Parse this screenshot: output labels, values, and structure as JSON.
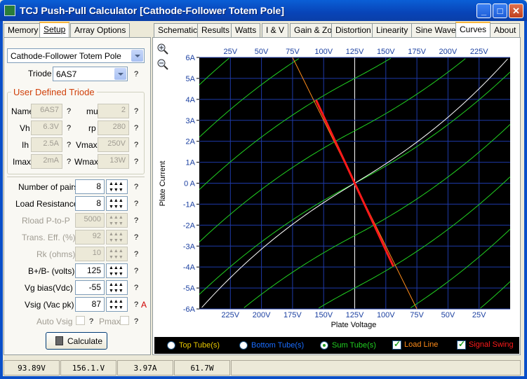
{
  "window": {
    "title": "TCJ Push-Pull Calculator [Cathode-Follower Totem Pole]",
    "minimize": "_",
    "maximize": "□",
    "close": "✕"
  },
  "left_tabs": [
    {
      "label": "Memory"
    },
    {
      "label": "Setup"
    },
    {
      "label": "Array Options"
    }
  ],
  "right_tabs": [
    {
      "label": "Schematic"
    },
    {
      "label": "Results"
    },
    {
      "label": "Watts"
    },
    {
      "label": "I & V"
    },
    {
      "label": "Gain & Zo"
    },
    {
      "label": "Distortion"
    },
    {
      "label": "Linearity"
    },
    {
      "label": "Sine Wave"
    },
    {
      "label": "Curves"
    },
    {
      "label": "About"
    }
  ],
  "setup": {
    "topology": "Cathode-Follower Totem Pole",
    "triode_label": "Triode",
    "triode_value": "6AS7",
    "group_title": "User Defined Triode",
    "user_triode": {
      "name_label": "Name",
      "name_value": "6AS7",
      "mu_label": "mu",
      "mu_value": "2",
      "vh_label": "Vh",
      "vh_value": "6.3V",
      "rp_label": "rp",
      "rp_value": "280",
      "ih_label": "Ih",
      "ih_value": "2.5A",
      "vmax_label": "Vmax",
      "vmax_value": "250V",
      "imax_label": "Imax",
      "imax_value": "2mA",
      "wmax_label": "Wmax",
      "wmax_value": "13W"
    },
    "fields": [
      {
        "label": "Number of pairs",
        "value": "8"
      },
      {
        "label": "Load Resistance",
        "value": "8"
      },
      {
        "label": "Rload P-to-P",
        "value": "5000"
      },
      {
        "label": "Trans. Eff. (%)",
        "value": "92"
      },
      {
        "label": "Rk (ohms)",
        "value": "10"
      },
      {
        "label": "B+/B- (volts)",
        "value": "125"
      },
      {
        "label": "Vg bias(Vdc)",
        "value": "-55"
      },
      {
        "label": "Vsig (Vac pk)",
        "value": "87"
      }
    ],
    "help": "?",
    "vsig_flag": "A",
    "auto_vsig": "Auto Vsig",
    "pmax": "Pmax",
    "calculate": "Calculate"
  },
  "status": [
    "93.89V",
    "156.1.V",
    "3.97A",
    "61.7W"
  ],
  "legend": [
    {
      "label": "Top Tube(s)",
      "color": "#e8c800",
      "selected": false,
      "type": "radio"
    },
    {
      "label": "Bottom Tube(s)",
      "color": "#1a6dff",
      "selected": false,
      "type": "radio"
    },
    {
      "label": "Sum Tube(s)",
      "color": "#21d021",
      "selected": true,
      "type": "radio"
    },
    {
      "label": "Load Line",
      "color": "#ff8c1a",
      "selected": true,
      "type": "check"
    },
    {
      "label": "Signal Swing",
      "color": "#ff1a1a",
      "selected": true,
      "type": "check"
    }
  ],
  "chart_data": {
    "type": "line",
    "xlabel": "Plate Voltage",
    "ylabel": "Plate Current",
    "x_top_ticks": [
      "25V",
      "50V",
      "75V",
      "100V",
      "125V",
      "150V",
      "175V",
      "200V",
      "225V"
    ],
    "x_bottom_ticks": [
      "225V",
      "200V",
      "175V",
      "150V",
      "125V",
      "100V",
      "75V",
      "50V",
      "25V"
    ],
    "y_ticks": [
      "6A",
      "5A",
      "4A",
      "3A",
      "2A",
      "1A",
      "0 A",
      "-1A",
      "-2A",
      "-3A",
      "-4A",
      "-5A",
      "-6A"
    ],
    "xlim": [
      0,
      250
    ],
    "ylim": [
      -6,
      6
    ],
    "grid": true,
    "center_x": 125,
    "family_offsets": [
      -10,
      -7.5,
      -5,
      -2.5,
      0,
      2.5,
      5,
      7.5,
      10
    ],
    "load_line": {
      "color": "#ff8c1a",
      "points": [
        [
          75,
          6
        ],
        [
          175,
          -6
        ]
      ]
    },
    "signal_swing": {
      "color": "#ff1a1a",
      "points": [
        [
          93.89,
          3.97
        ],
        [
          156.1,
          -3.97
        ]
      ]
    },
    "sum_curve_color": "#ffffff",
    "family_color": "#21d021"
  }
}
